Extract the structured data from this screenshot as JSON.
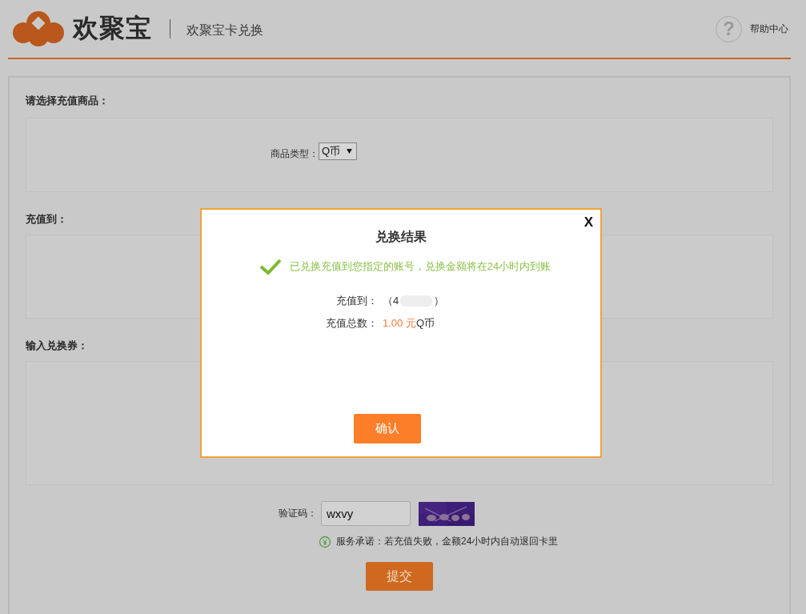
{
  "header": {
    "brand": "欢聚宝",
    "subtitle": "欢聚宝卡兑换",
    "help_icon": "?",
    "help": "帮助中心"
  },
  "sections": [
    {
      "label": "请选择充值商品：",
      "kind": "product",
      "field_label": "商品类型：",
      "select_value": "Q币"
    },
    {
      "label": "充值到：",
      "kind": "empty"
    },
    {
      "label": "输入兑换券：",
      "kind": "empty"
    }
  ],
  "captcha": {
    "label": "验证码：",
    "value": "wxvy"
  },
  "promise": "服务承诺：若充值失败，金额24小时内自动退回卡里",
  "submit": "提交",
  "dialog": {
    "title": "兑换结果",
    "close": "X",
    "message": "已兑换充值到您指定的账号，兑换金额将在24小时内到账",
    "rows": [
      {
        "label": "充值到：",
        "kind": "account",
        "value": "（4",
        "value_end": "）"
      },
      {
        "label": "充值总数：",
        "kind": "amount",
        "amount": "1.00 元",
        "unit": "Q币"
      }
    ],
    "confirm": "确认"
  }
}
